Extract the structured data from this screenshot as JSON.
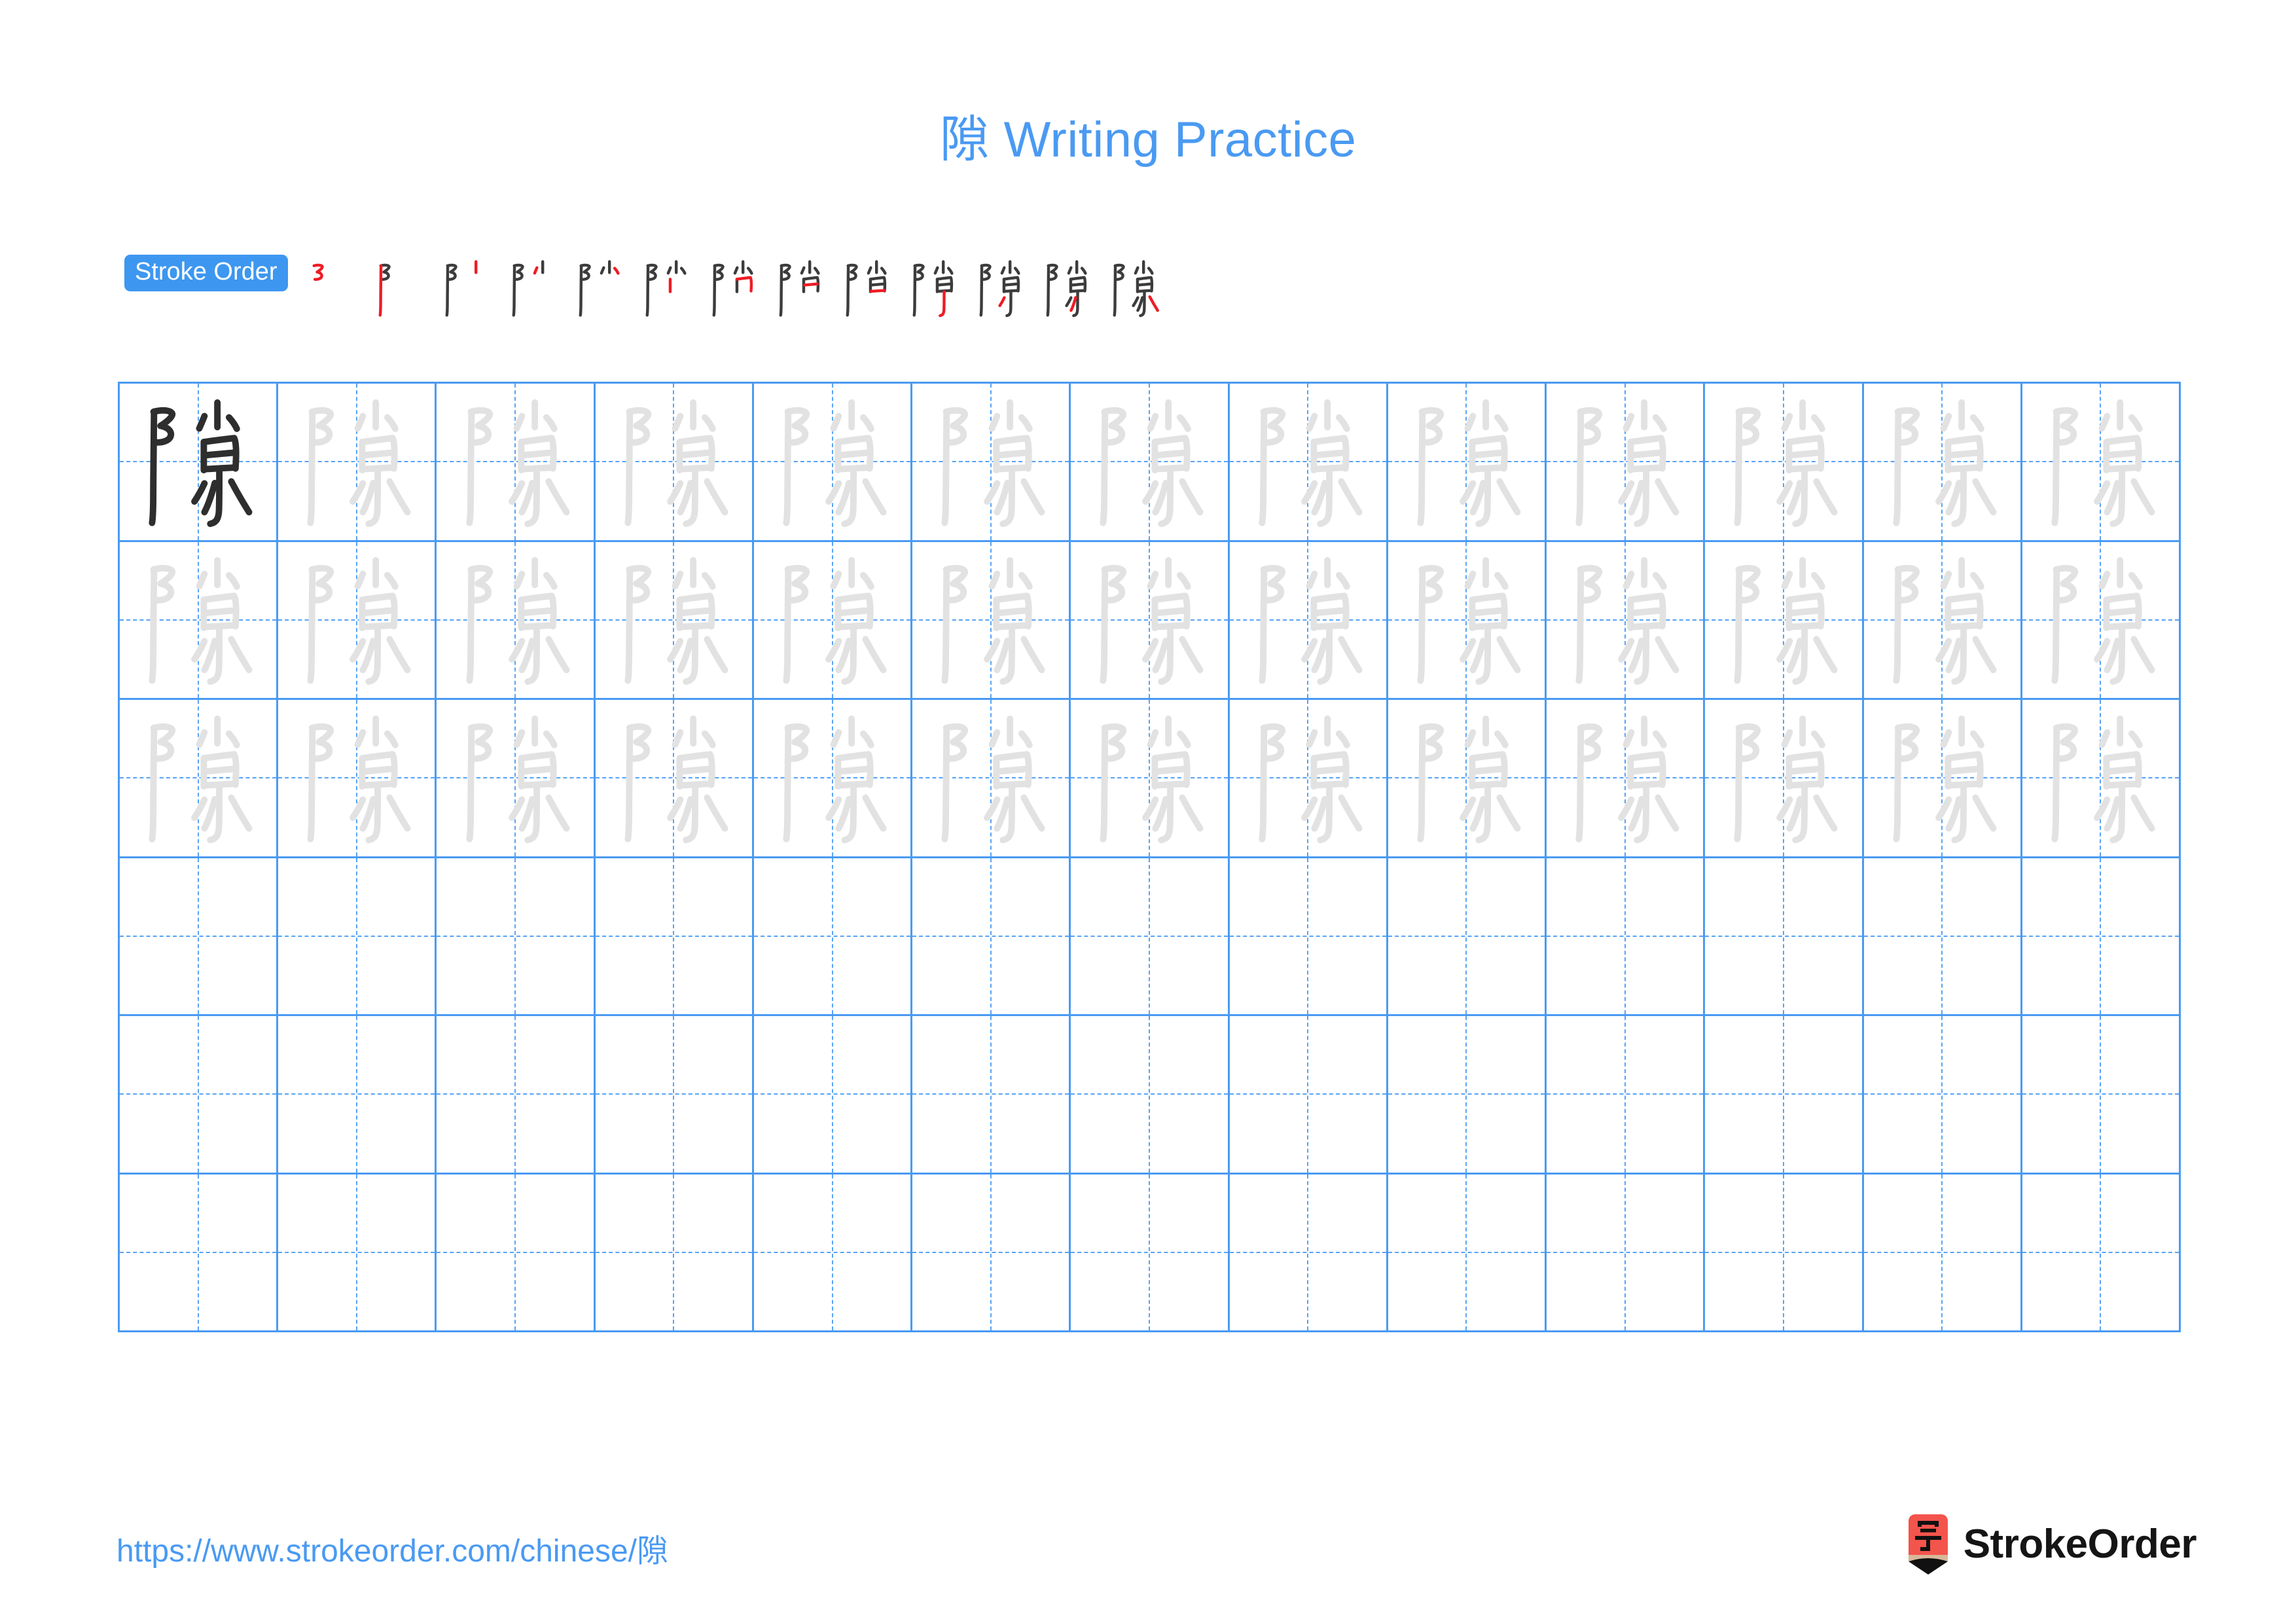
{
  "document": {
    "character": "隙",
    "title_text": "隙 Writing Practice",
    "title_suffix": "Writing Practice"
  },
  "stroke_order": {
    "badge_label": "Stroke Order",
    "total_steps": 13,
    "accent_color": "#3d97f0",
    "new_stroke_color": "#ee1c25",
    "done_stroke_color": "#3c3c3c",
    "steps": [
      {
        "index": 1,
        "strokes_shown": 1,
        "label": "stroke-step-1"
      },
      {
        "index": 2,
        "strokes_shown": 2,
        "label": "stroke-step-2"
      },
      {
        "index": 3,
        "strokes_shown": 3,
        "label": "stroke-step-3"
      },
      {
        "index": 4,
        "strokes_shown": 4,
        "label": "stroke-step-4"
      },
      {
        "index": 5,
        "strokes_shown": 5,
        "label": "stroke-step-5"
      },
      {
        "index": 6,
        "strokes_shown": 6,
        "label": "stroke-step-6"
      },
      {
        "index": 7,
        "strokes_shown": 7,
        "label": "stroke-step-7"
      },
      {
        "index": 8,
        "strokes_shown": 8,
        "label": "stroke-step-8"
      },
      {
        "index": 9,
        "strokes_shown": 9,
        "label": "stroke-step-9"
      },
      {
        "index": 10,
        "strokes_shown": 10,
        "label": "stroke-step-10"
      },
      {
        "index": 11,
        "strokes_shown": 11,
        "label": "stroke-step-11"
      },
      {
        "index": 12,
        "strokes_shown": 12,
        "label": "stroke-step-12"
      },
      {
        "index": 13,
        "strokes_shown": 13,
        "label": "stroke-step-13"
      }
    ]
  },
  "practice_grid": {
    "columns": 13,
    "rows": 6,
    "line_color": "#4a9af2",
    "guide_line_color": "#57a3f5",
    "model_char_color": "#2e2e2e",
    "trace_char_color": "#e2e2e2",
    "rows_data": [
      {
        "row": 1,
        "cells": [
          "隙",
          "隙",
          "隙",
          "隙",
          "隙",
          "隙",
          "隙",
          "隙",
          "隙",
          "隙",
          "隙",
          "隙",
          "隙"
        ],
        "styles": [
          "model",
          "trace",
          "trace",
          "trace",
          "trace",
          "trace",
          "trace",
          "trace",
          "trace",
          "trace",
          "trace",
          "trace",
          "trace"
        ]
      },
      {
        "row": 2,
        "cells": [
          "隙",
          "隙",
          "隙",
          "隙",
          "隙",
          "隙",
          "隙",
          "隙",
          "隙",
          "隙",
          "隙",
          "隙",
          "隙"
        ],
        "styles": [
          "trace",
          "trace",
          "trace",
          "trace",
          "trace",
          "trace",
          "trace",
          "trace",
          "trace",
          "trace",
          "trace",
          "trace",
          "trace"
        ]
      },
      {
        "row": 3,
        "cells": [
          "隙",
          "隙",
          "隙",
          "隙",
          "隙",
          "隙",
          "隙",
          "隙",
          "隙",
          "隙",
          "隙",
          "隙",
          "隙"
        ],
        "styles": [
          "trace",
          "trace",
          "trace",
          "trace",
          "trace",
          "trace",
          "trace",
          "trace",
          "trace",
          "trace",
          "trace",
          "trace",
          "trace"
        ]
      },
      {
        "row": 4,
        "cells": [
          "",
          "",
          "",
          "",
          "",
          "",
          "",
          "",
          "",
          "",
          "",
          "",
          ""
        ],
        "styles": [
          "empty",
          "empty",
          "empty",
          "empty",
          "empty",
          "empty",
          "empty",
          "empty",
          "empty",
          "empty",
          "empty",
          "empty",
          "empty"
        ]
      },
      {
        "row": 5,
        "cells": [
          "",
          "",
          "",
          "",
          "",
          "",
          "",
          "",
          "",
          "",
          "",
          "",
          ""
        ],
        "styles": [
          "empty",
          "empty",
          "empty",
          "empty",
          "empty",
          "empty",
          "empty",
          "empty",
          "empty",
          "empty",
          "empty",
          "empty",
          "empty"
        ]
      },
      {
        "row": 6,
        "cells": [
          "",
          "",
          "",
          "",
          "",
          "",
          "",
          "",
          "",
          "",
          "",
          "",
          ""
        ],
        "styles": [
          "empty",
          "empty",
          "empty",
          "empty",
          "empty",
          "empty",
          "empty",
          "empty",
          "empty",
          "empty",
          "empty",
          "empty",
          "empty"
        ]
      }
    ]
  },
  "footer": {
    "url": "https://www.strokeorder.com/chinese/隙",
    "brand_name": "StrokeOrder",
    "logo_char": "字",
    "logo_body_color": "#f3544c",
    "logo_wood_color": "#d8b89a",
    "logo_tip_color": "#111111"
  }
}
